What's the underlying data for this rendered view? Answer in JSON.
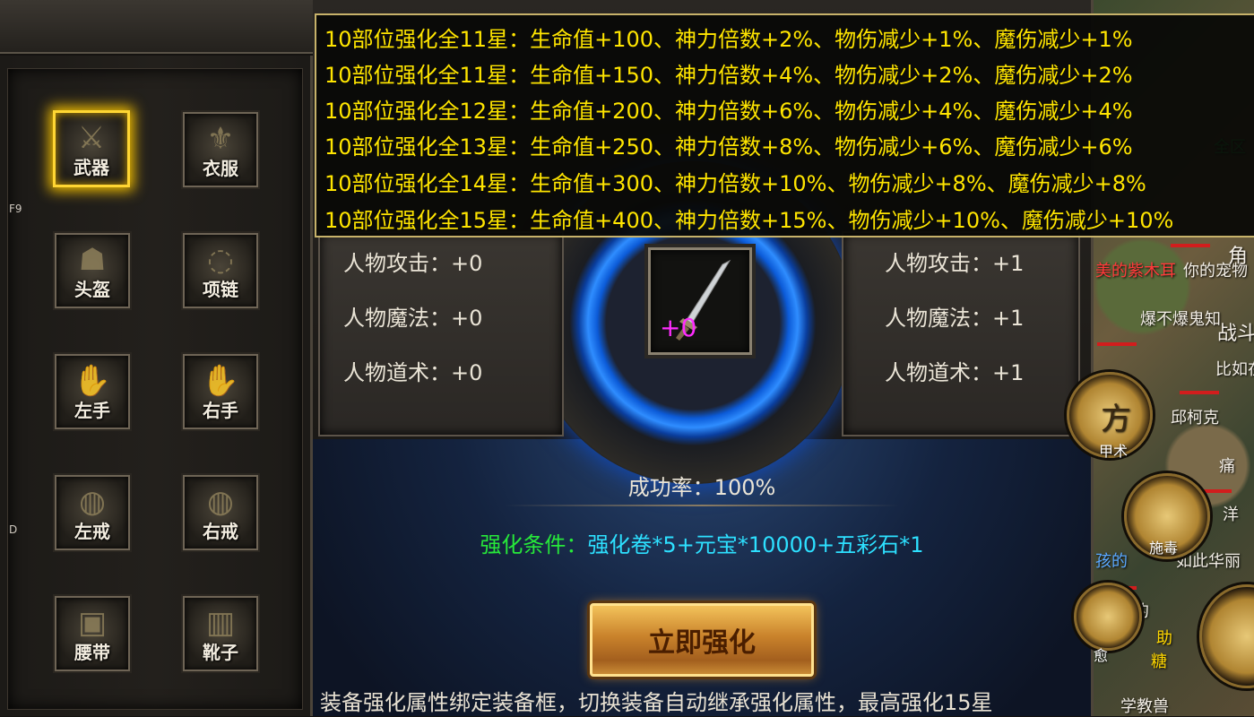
{
  "hotkeys": {
    "f9": "F9",
    "d": "D"
  },
  "equipment_slots": [
    {
      "label": "武器",
      "glyph": "⚔",
      "selected": true
    },
    {
      "label": "衣服",
      "glyph": "⚜",
      "selected": false
    },
    {
      "label": "头盔",
      "glyph": "☗",
      "selected": false
    },
    {
      "label": "项链",
      "glyph": "◌",
      "selected": false
    },
    {
      "label": "左手",
      "glyph": "✋",
      "selected": false
    },
    {
      "label": "右手",
      "glyph": "✋",
      "selected": false
    },
    {
      "label": "左戒",
      "glyph": "◍",
      "selected": false
    },
    {
      "label": "右戒",
      "glyph": "◍",
      "selected": false
    },
    {
      "label": "腰带",
      "glyph": "▣",
      "selected": false
    },
    {
      "label": "靴子",
      "glyph": "▥",
      "selected": false
    }
  ],
  "tooltip": {
    "lines": [
      "10部位强化全11星：生命值+100、神力倍数+2%、物伤减少+1%、魔伤减少+1%",
      "10部位强化全11星：生命值+150、神力倍数+4%、物伤减少+2%、魔伤减少+2%",
      "10部位强化全12星：生命值+200、神力倍数+6%、物伤减少+4%、魔伤减少+4%",
      "10部位强化全13星：生命值+250、神力倍数+8%、物伤减少+6%、魔伤减少+6%",
      "10部位强化全14星：生命值+300、神力倍数+10%、物伤减少+8%、魔伤减少+8%",
      "10部位强化全15星：生命值+400、神力倍数+15%、物伤减少+10%、魔伤减少+10%"
    ]
  },
  "stats_current": [
    {
      "label": "人物攻击：",
      "value": "+0"
    },
    {
      "label": "人物魔法：",
      "value": "+0"
    },
    {
      "label": "人物道术：",
      "value": "+0"
    }
  ],
  "stats_next": [
    {
      "label": "人物攻击：",
      "value": "+1"
    },
    {
      "label": "人物魔法：",
      "value": "+1"
    },
    {
      "label": "人物道术：",
      "value": "+1"
    }
  ],
  "item": {
    "level": "+0",
    "icon": "sword-icon"
  },
  "success_rate": "成功率：100%",
  "condition": {
    "label": "强化条件：",
    "value": "强化卷*5+元宝*10000+五彩石*1"
  },
  "enhance_button": "立即强化",
  "footer_note": "装备强化属性绑定装备框，切换装备自动继承强化属性，最高强化15星",
  "world": {
    "texts": [
      "美的紫木耳",
      "你的宠物",
      "爆不爆鬼知",
      "比如在",
      "邱柯克",
      "痛",
      "洋",
      "孩的",
      "如此华丽",
      "的",
      "助",
      "糖",
      "学教兽",
      "全区",
      "角",
      "战斗"
    ],
    "orbs": [
      "方",
      "甲术",
      "施毒",
      "愈"
    ]
  },
  "colors": {
    "tooltip_text": "#ffe500",
    "condition_label": "#27e83a",
    "condition_value": "#2de0ff",
    "item_level": "#ff2cff",
    "selected_glow": "#ffd633"
  }
}
